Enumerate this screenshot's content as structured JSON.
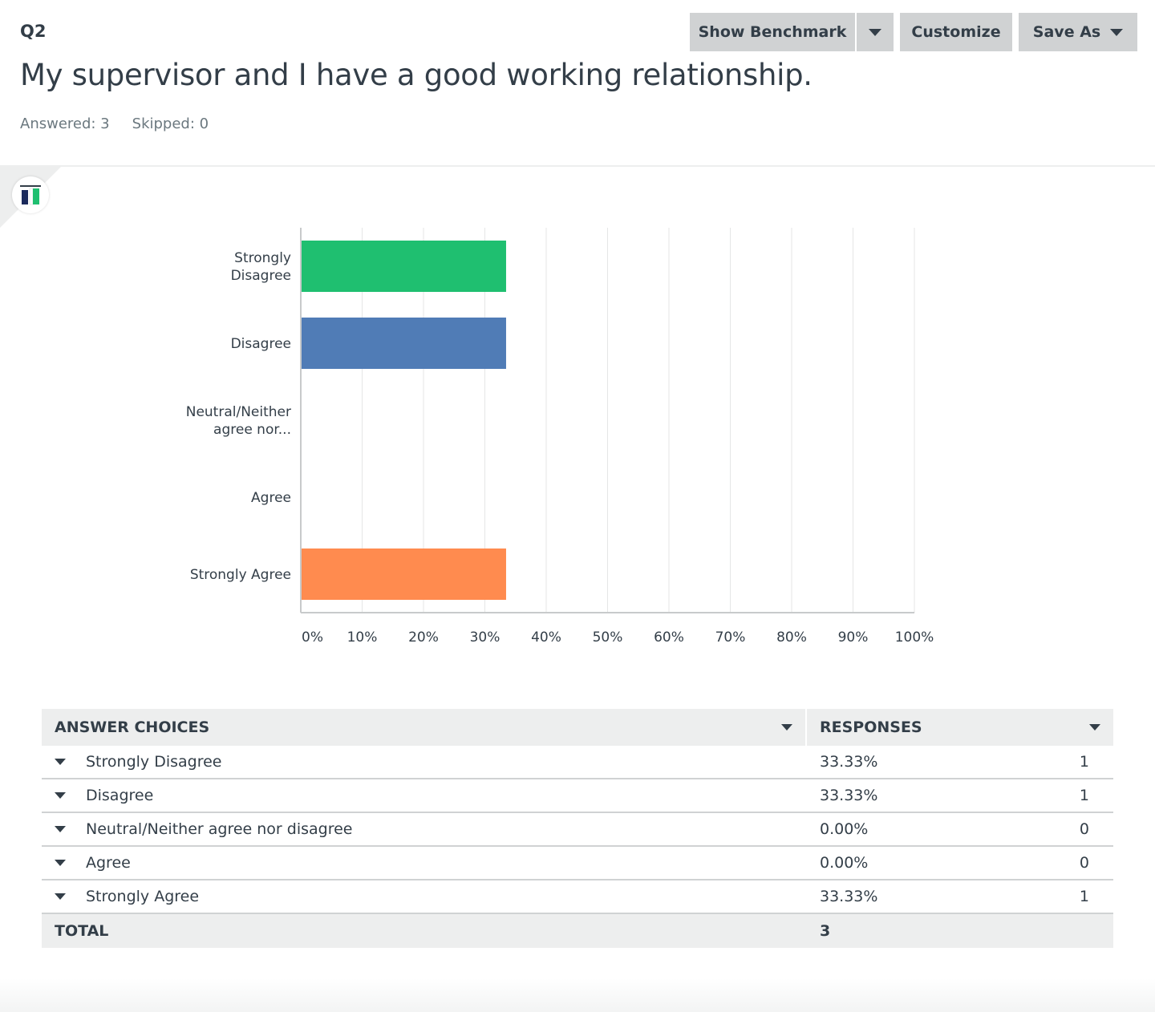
{
  "question": {
    "number": "Q2",
    "title": "My supervisor and I have a good working relationship.",
    "answered": "Answered: 3",
    "skipped": "Skipped: 0"
  },
  "toolbar": {
    "benchmark_label": "Show Benchmark",
    "customize_label": "Customize",
    "save_as_label": "Save As"
  },
  "chart_data": {
    "type": "bar",
    "orientation": "horizontal",
    "categories": [
      "Strongly Disagree",
      "Disagree",
      "Neutral/Neither agree nor...",
      "Agree",
      "Strongly Agree"
    ],
    "category_lines": [
      [
        "Strongly",
        "Disagree"
      ],
      [
        "Disagree"
      ],
      [
        "Neutral/Neither",
        "agree nor..."
      ],
      [
        "Agree"
      ],
      [
        "Strongly Agree"
      ]
    ],
    "values": [
      33.33,
      33.33,
      0,
      0,
      33.33
    ],
    "colors": [
      "#1fbf70",
      "#507cb6",
      "#6bc8cd",
      "#f9be00",
      "#ff8b4f"
    ],
    "xlim": [
      0,
      100
    ],
    "ticks": [
      "0%",
      "10%",
      "20%",
      "30%",
      "40%",
      "50%",
      "60%",
      "70%",
      "80%",
      "90%",
      "100%"
    ],
    "grid": true
  },
  "table": {
    "headers": {
      "choices": "ANSWER CHOICES",
      "responses": "RESPONSES"
    },
    "rows": [
      {
        "choice": "Strongly Disagree",
        "percent": "33.33%",
        "count": "1"
      },
      {
        "choice": "Disagree",
        "percent": "33.33%",
        "count": "1"
      },
      {
        "choice": "Neutral/Neither agree nor disagree",
        "percent": "0.00%",
        "count": "0"
      },
      {
        "choice": "Agree",
        "percent": "0.00%",
        "count": "0"
      },
      {
        "choice": "Strongly Agree",
        "percent": "33.33%",
        "count": "1"
      }
    ],
    "total_label": "TOTAL",
    "total_value": "3"
  }
}
